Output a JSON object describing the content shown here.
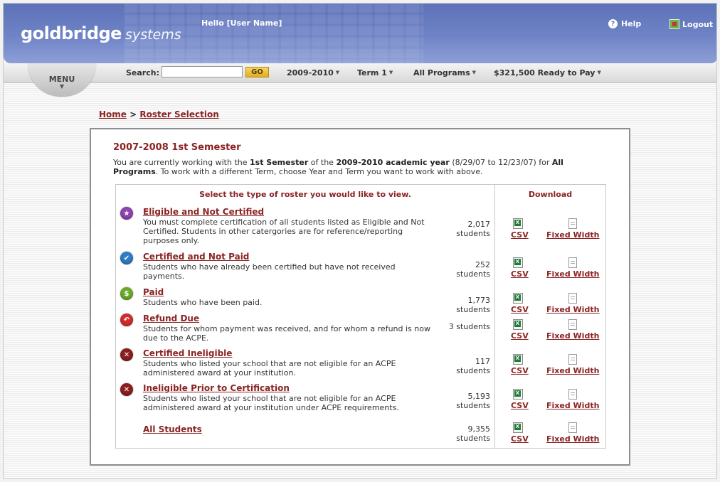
{
  "header": {
    "logo_bold": "goldbridge",
    "logo_light": "systems",
    "greeting": "Hello [User Name]",
    "help_label": "Help",
    "logout_label": "Logout"
  },
  "nav": {
    "menu_label": "MENU",
    "search_label": "Search:",
    "search_value": "",
    "go_label": "GO",
    "year": "2009-2010",
    "term": "Term 1",
    "programs": "All Programs",
    "pay": "$321,500 Ready to Pay"
  },
  "breadcrumb": {
    "home": "Home",
    "sep": ">",
    "current": "Roster Selection"
  },
  "panel": {
    "title": "2007-2008 1st Semester",
    "desc_parts": {
      "p1": "You are currently working with the ",
      "b1": "1st Semester",
      "p2": " of the ",
      "b2": "2009-2010 academic year",
      "p3": " (8/29/07 to 12/23/07) for ",
      "b3": "All Programs",
      "p4": ". To work with a different Term, choose Year and Term you want to work with above."
    },
    "col_select": "Select the type of roster you would like to view.",
    "col_download": "Download",
    "csv_label": "CSV",
    "fixed_label": "Fixed Width",
    "rows": [
      {
        "title": "Eligible and Not Certified",
        "desc": "You must complete certification of all students listed as Eligible and Not Certified. Students in other catergories are for reference/reporting purposes only.",
        "count": "2,017",
        "unit": "students",
        "icon": "star-icon",
        "color": "#8e44ad"
      },
      {
        "title": "Certified and Not Paid",
        "desc": "Students who have already been certified but have not received payments.",
        "count": "252",
        "unit": "students",
        "icon": "checkmark-icon",
        "color": "#2f7cc4"
      },
      {
        "title": "Paid",
        "desc": "Students who have been paid.",
        "count": "1,773",
        "unit": "students",
        "icon": "dollar-icon",
        "color": "#6aaa2a"
      },
      {
        "title": "Refund Due",
        "desc": "Students for whom payment was received, and for whom a refund is now due to the ACPE.",
        "count": "3 students",
        "unit": "",
        "icon": "refund-arrow-icon",
        "color": "#d02d2d"
      },
      {
        "title": "Certified Ineligible",
        "desc": "Students who listed your school that are not eligible for an ACPE administered award at your institution.",
        "count": "117",
        "unit": "students",
        "icon": "x-circle-icon",
        "color": "#8b1f1f"
      },
      {
        "title": "Ineligible Prior to Certification",
        "desc": "Students who listed your school that are not eligible for an ACPE administered award at your institution under ACPE requirements.",
        "count": "5,193",
        "unit": "students",
        "icon": "x-circle-icon",
        "color": "#8b1f1f"
      },
      {
        "title": "All Students",
        "desc": "",
        "count": "9,355",
        "unit": "students",
        "icon": "",
        "color": ""
      }
    ]
  }
}
